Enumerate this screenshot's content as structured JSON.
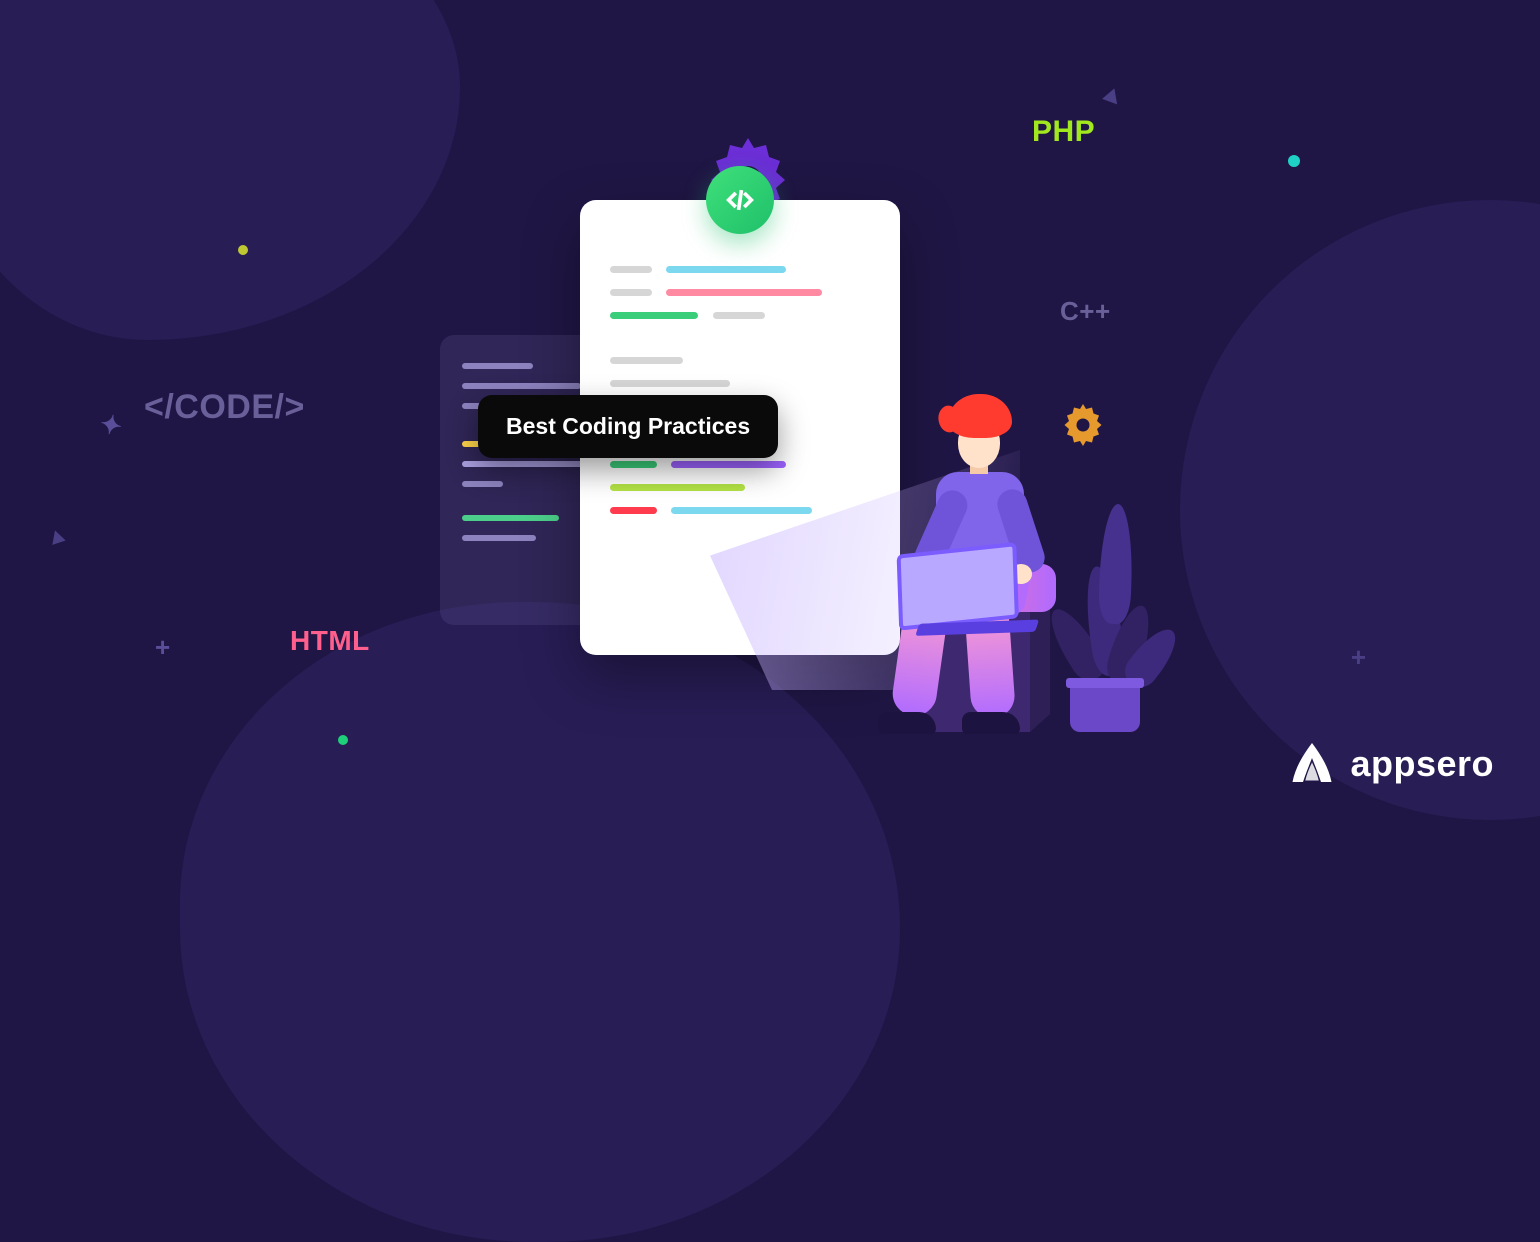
{
  "title_pill": "Best Coding Practices",
  "labels": {
    "php": "PHP",
    "cpp": "C++",
    "code_tag": "</CODE/>",
    "html": "HTML"
  },
  "brand": {
    "name": "appsero"
  },
  "icons": {
    "gear_purple": "gear-icon",
    "gear_orange": "gear-icon",
    "code_badge": "code-slash-icon",
    "logo_mark": "appsero-logo-mark"
  },
  "colors": {
    "bg": "#201645",
    "blob": "#281d55",
    "accent_green": "#a2e81f",
    "accent_pink": "#ff5f8d",
    "muted": "#6a6099",
    "badge_green": "#1fc06a",
    "pill_bg": "#0a0a0a"
  }
}
